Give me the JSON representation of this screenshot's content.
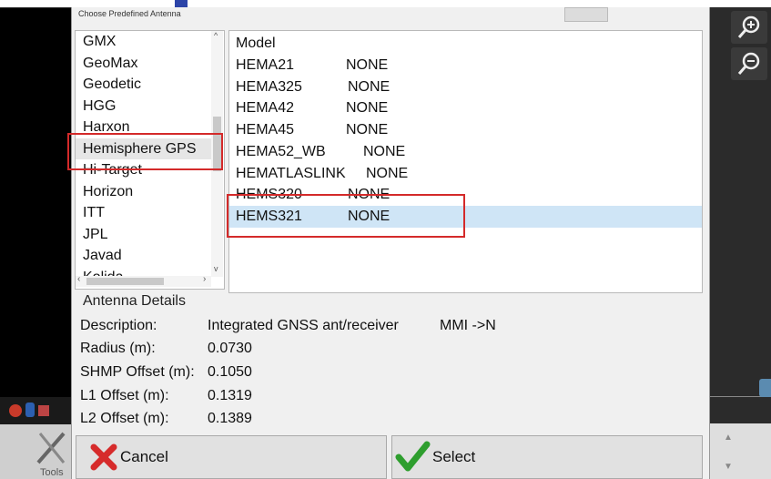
{
  "dialog": {
    "title": "Choose Predefined Antenna"
  },
  "manufacturers": {
    "items": [
      "GMX",
      "GeoMax",
      "Geodetic",
      "HGG",
      "Harxon",
      "Hemisphere GPS",
      "Hi-Target",
      "Horizon",
      "ITT",
      "JPL",
      "Javad",
      "Kolida"
    ],
    "selected": "Hemisphere GPS"
  },
  "models": {
    "header": "Model",
    "rows": [
      {
        "name": "HEMA21",
        "type": "NONE"
      },
      {
        "name": "HEMA325",
        "type": "NONE"
      },
      {
        "name": "HEMA42",
        "type": "NONE"
      },
      {
        "name": "HEMA45",
        "type": "NONE"
      },
      {
        "name": "HEMA52_WB",
        "type": "NONE"
      },
      {
        "name": "HEMATLASLINK",
        "type": "NONE"
      },
      {
        "name": "HEMS320",
        "type": "NONE"
      },
      {
        "name": "HEMS321",
        "type": "NONE"
      }
    ],
    "selected": "HEMS321"
  },
  "details": {
    "title": "Antenna Details",
    "description_label": "Description:",
    "description_value": "Integrated GNSS ant/receiver",
    "description_extra": "MMI ->N",
    "radius_label": "Radius (m):",
    "radius_value": "0.0730",
    "shmp_label": "SHMP Offset (m):",
    "shmp_value": "0.1050",
    "l1_label": "L1 Offset (m):",
    "l1_value": "0.1319",
    "l2_label": "L2 Offset (m):",
    "l2_value": "0.1389"
  },
  "buttons": {
    "cancel": "Cancel",
    "select": "Select"
  },
  "left_bar": {
    "tools_label": "Tools"
  },
  "icons": {
    "zoom_in": "zoom-in-icon",
    "zoom_out": "zoom-out-icon",
    "cancel": "red-x-icon",
    "select": "green-check-icon"
  },
  "colors": {
    "highlight": "#d42a2a",
    "selected_row": "#cfe5f6",
    "check_green": "#2e9e2e",
    "cancel_red": "#d62b2b"
  }
}
